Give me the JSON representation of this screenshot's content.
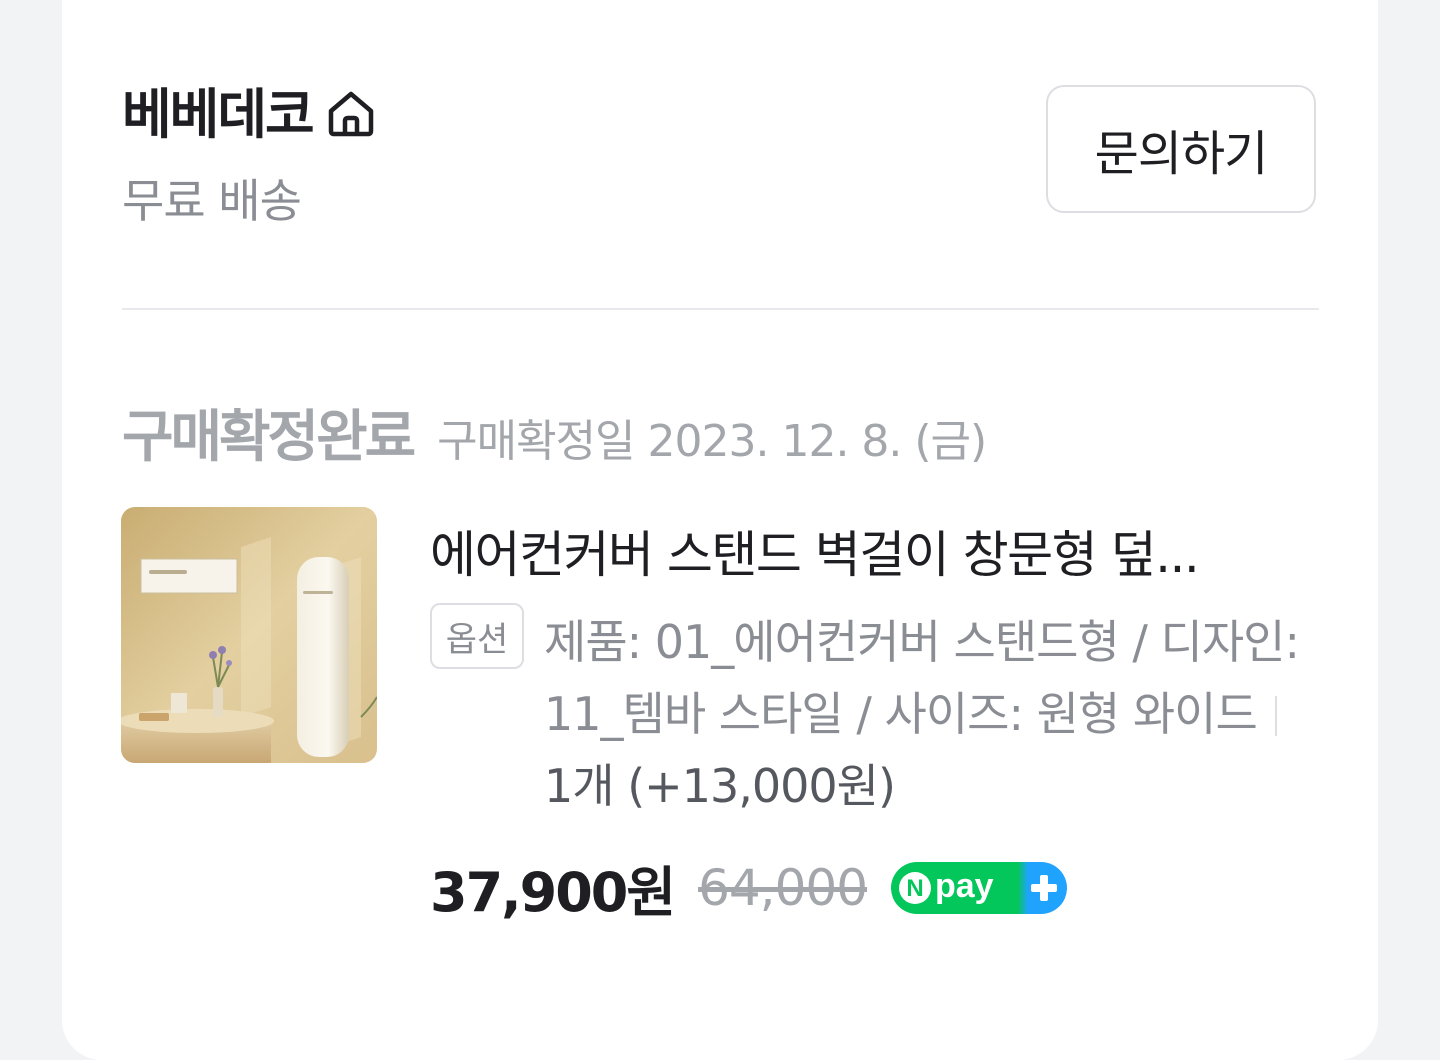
{
  "store": {
    "name": "베베데코",
    "shipping": "무료 배송",
    "inquiry_label": "문의하기"
  },
  "order": {
    "status": "구매확정완료",
    "confirm_date": "구매확정일 2023. 12. 8. (금)"
  },
  "product": {
    "name": "에어컨커버 스탠드 벽걸이 창문형 덮...",
    "option_badge": "옵션",
    "option_text": "제품: 01_에어컨커버 스탠드형 / 디자인: 11_템바 스타일 / 사이즈: 원형 와이드",
    "quantity": "1개 (+13,000원)",
    "price": "37,900원",
    "original_price": "64,000",
    "npay_label": "pay"
  },
  "colors": {
    "npay_green": "#03c75a",
    "npay_blue": "#1fa3ff"
  },
  "icons": {
    "store": "home-icon"
  }
}
